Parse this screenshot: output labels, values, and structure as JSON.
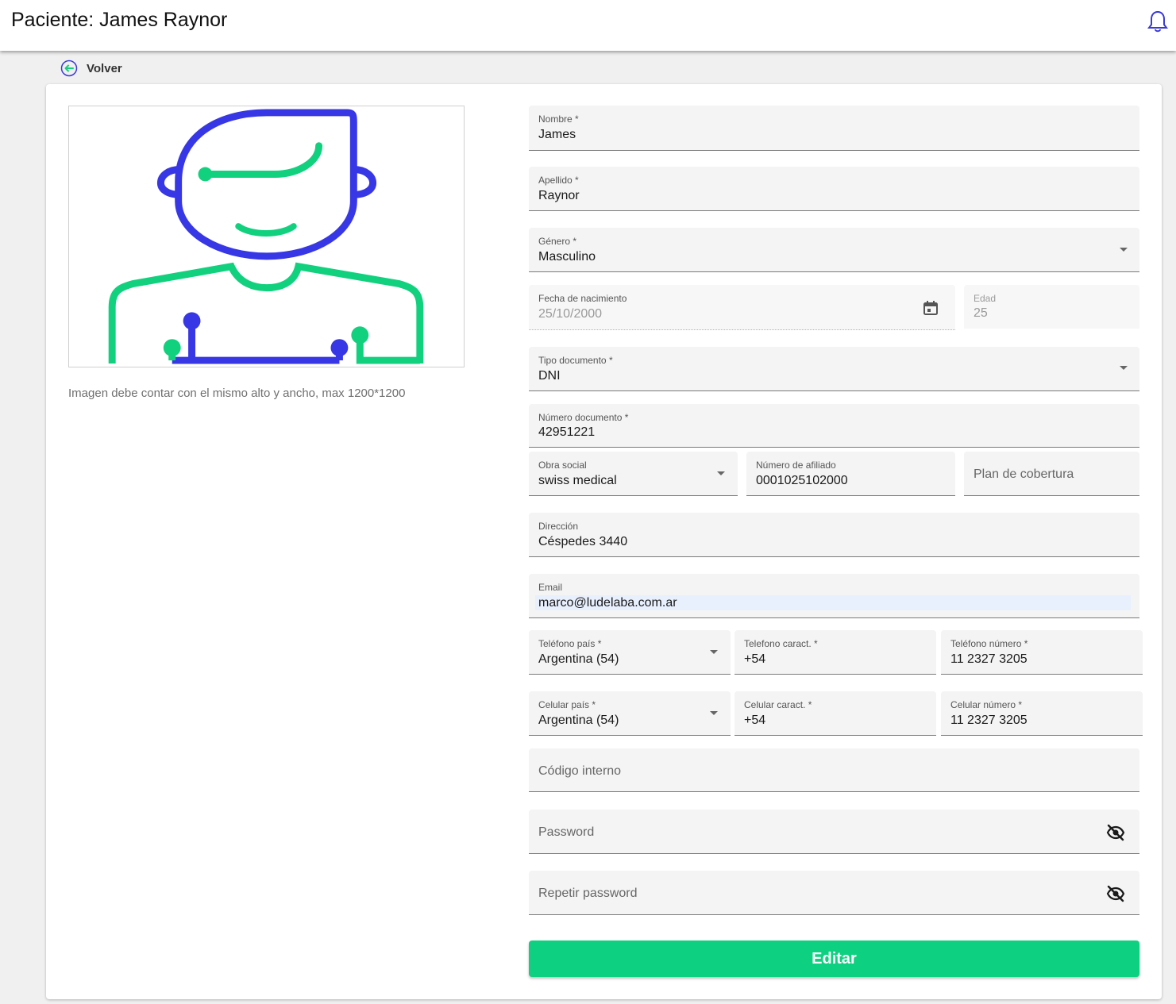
{
  "header": {
    "title": "Paciente: James Raynor",
    "bell_icon": "bell-icon"
  },
  "back": {
    "label": "Volver",
    "icon": "arrow-left-circle-icon"
  },
  "photo": {
    "hint": "Imagen debe contar con el mismo alto y ancho, max 1200*1200",
    "colors": {
      "head": "#3737e6",
      "body": "#12d17e"
    }
  },
  "form": {
    "nombre": {
      "label": "Nombre *",
      "value": "James"
    },
    "apellido": {
      "label": "Apellido *",
      "value": "Raynor"
    },
    "genero": {
      "label": "Género *",
      "value": "Masculino"
    },
    "fecha_nacimiento": {
      "label": "Fecha de nacimiento",
      "value": "25/10/2000"
    },
    "edad": {
      "label": "Edad",
      "value": "25"
    },
    "tipo_documento": {
      "label": "Tipo documento *",
      "value": "DNI"
    },
    "numero_documento": {
      "label": "Número documento *",
      "value": "42951221"
    },
    "obra_social": {
      "label": "Obra social",
      "value": "swiss medical"
    },
    "numero_afiliado": {
      "label": "Número de afiliado",
      "value": "0001025102000"
    },
    "plan_cobertura": {
      "placeholder": "Plan de cobertura"
    },
    "direccion": {
      "label": "Dirección",
      "value": "Céspedes 3440"
    },
    "email": {
      "label": "Email",
      "value": "marco@ludelaba.com.ar"
    },
    "telefono_pais": {
      "label": "Teléfono país *",
      "value": "Argentina (54)"
    },
    "telefono_caract": {
      "label": "Telefono caract. *",
      "value": "+54"
    },
    "telefono_numero": {
      "label": "Teléfono número *",
      "value": "11 2327 3205"
    },
    "celular_pais": {
      "label": "Celular país *",
      "value": "Argentina (54)"
    },
    "celular_caract": {
      "label": "Celular caract. *",
      "value": "+54"
    },
    "celular_numero": {
      "label": "Celular número *",
      "value": "11 2327 3205"
    },
    "codigo_interno": {
      "placeholder": "Código interno"
    },
    "password": {
      "placeholder": "Password"
    },
    "repetir_password": {
      "placeholder": "Repetir password"
    }
  },
  "submit": {
    "label": "Editar",
    "color": "#0dd180"
  }
}
